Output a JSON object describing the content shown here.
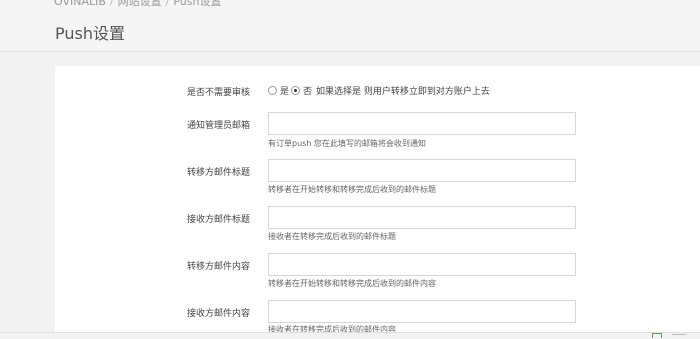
{
  "breadcrumb": {
    "home": "OVINALIB",
    "parent": "网站设置",
    "current": "Push设置"
  },
  "page_title": "Push设置",
  "form": {
    "review": {
      "label": "是否不需要审核",
      "option_yes": "是",
      "option_no": "否",
      "selected": "否",
      "help": "如果选择是 则用户转移立即到对方账户上去"
    },
    "admin_email": {
      "label": "通知管理员邮箱",
      "value": "",
      "help": "有订单push 您在此填写的邮箱将会收到通知"
    },
    "sender_subject": {
      "label": "转移方邮件标题",
      "value": "",
      "help": "转移者在开始转移和转移完成后收到的邮件标题"
    },
    "receiver_subject": {
      "label": "接收方邮件标题",
      "value": "",
      "help": "接收者在转移完成后收到的邮件标题"
    },
    "sender_content": {
      "label": "转移方邮件内容",
      "value": "",
      "help": "转移者在开始转移和转移完成后收到的邮件内容"
    },
    "receiver_content": {
      "label": "接收方邮件内容",
      "value": "",
      "help": "接收者在转移完成后收到的邮件内容"
    }
  }
}
